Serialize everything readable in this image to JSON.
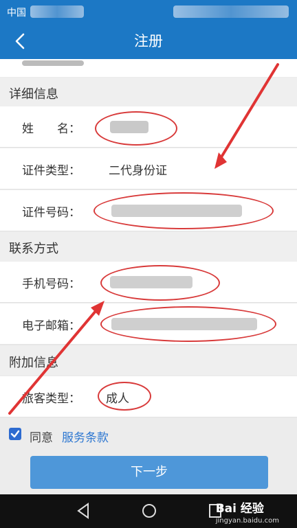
{
  "status_bar": {
    "carrier": "中国"
  },
  "header": {
    "title": "注册"
  },
  "sections": {
    "details": {
      "title": "详细信息",
      "name_label": "姓　　名：",
      "id_type_label": "证件类型：",
      "id_type_value": "二代身份证",
      "id_number_label": "证件号码："
    },
    "contact": {
      "title": "联系方式",
      "phone_label": "手机号码：",
      "email_label": "电子邮箱："
    },
    "extra": {
      "title": "附加信息",
      "passenger_type_label": "旅客类型：",
      "passenger_type_value": "成人"
    }
  },
  "agreement": {
    "checked": true,
    "agree_label": "同意",
    "terms_link": "服务条款"
  },
  "next_button": {
    "label": "下一步"
  },
  "watermark": {
    "text": "Bai 经验",
    "url": "jingyan.baidu.com"
  },
  "colors": {
    "primary": "#1c78c5",
    "button": "#4e97d9",
    "annotation": "#d83a3a",
    "link": "#2d77d1"
  }
}
